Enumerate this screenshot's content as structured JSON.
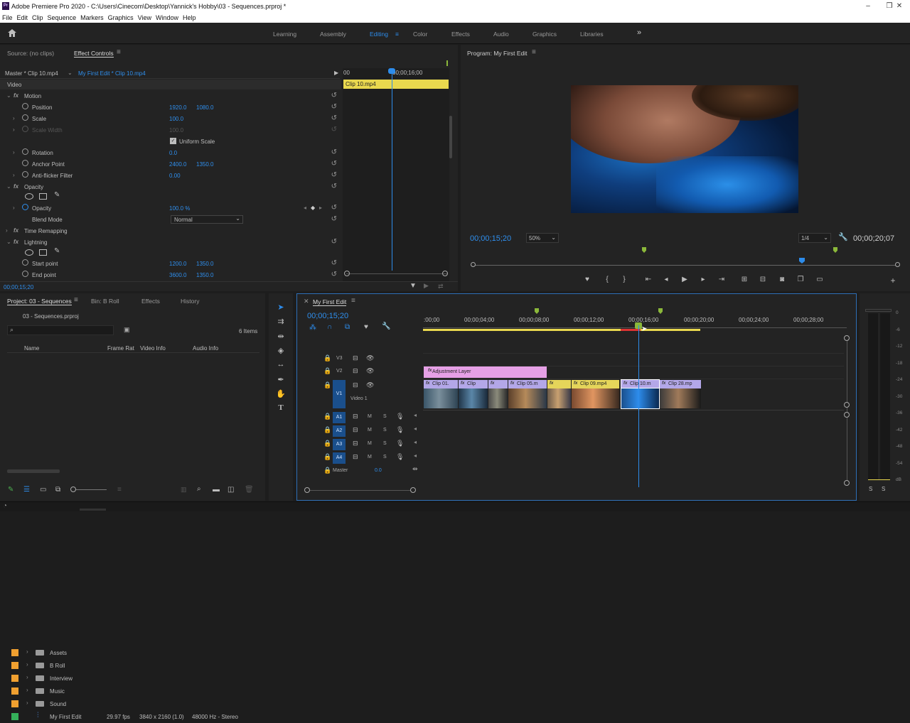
{
  "window": {
    "title": "Adobe Premiere Pro 2020 - C:\\Users\\Cinecom\\Desktop\\Yannick's Hobby\\03 - Sequences.prproj *",
    "app_icon_text": "Pr",
    "minimize": "–",
    "maximize": "❒",
    "close": "✕"
  },
  "menu": [
    "File",
    "Edit",
    "Clip",
    "Sequence",
    "Markers",
    "Graphics",
    "View",
    "Window",
    "Help"
  ],
  "workspaces": {
    "items": [
      "Learning",
      "Assembly",
      "Editing",
      "Color",
      "Effects",
      "Audio",
      "Graphics",
      "Libraries"
    ],
    "active": "Editing",
    "more": "»"
  },
  "effect_controls": {
    "source_tab": "Source: (no clips)",
    "tab": "Effect Controls",
    "master_clip": "Master * Clip 10.mp4",
    "sequence_clip": "My First Edit * Clip 10.mp4",
    "timecode_start": "00",
    "timecode_mark": "00;00;16;00",
    "clip_bar_label": "Clip 10.mp4",
    "section_video": "Video",
    "motion": {
      "label": "Motion",
      "position": {
        "label": "Position",
        "x": "1920.0",
        "y": "1080.0"
      },
      "scale": {
        "label": "Scale",
        "value": "100.0"
      },
      "scale_width": {
        "label": "Scale Width",
        "value": "100.0"
      },
      "uniform_scale": "Uniform Scale",
      "rotation": {
        "label": "Rotation",
        "value": "0.0"
      },
      "anchor_point": {
        "label": "Anchor Point",
        "x": "2400.0",
        "y": "1350.0"
      },
      "anti_flicker": {
        "label": "Anti-flicker Filter",
        "value": "0.00"
      }
    },
    "opacity": {
      "label": "Opacity",
      "value_label": "Opacity",
      "value": "100.0 %",
      "blend_mode_label": "Blend Mode",
      "blend_mode": "Normal"
    },
    "time_remapping": "Time Remapping",
    "lightning": {
      "label": "Lightning",
      "start_point": {
        "label": "Start point",
        "x": "1200.0",
        "y": "1350.0"
      },
      "end_point": {
        "label": "End point",
        "x": "3600.0",
        "y": "1350.0"
      }
    },
    "bottom_timecode": "00;00;15;20"
  },
  "program": {
    "title": "Program: My First Edit",
    "timecode": "00;00;15;20",
    "zoom": "50%",
    "resolution": "1/4",
    "duration": "00;00;20;07"
  },
  "project": {
    "tabs": [
      "Project: 03 - Sequences",
      "Bin: B Roll",
      "Effects",
      "History"
    ],
    "file": "03 - Sequences.prproj",
    "items_count": "6 Items",
    "columns": [
      "Name",
      "Frame Rat",
      "Video Info",
      "Audio Info"
    ],
    "rows": [
      {
        "name": "Assets",
        "color": "#f0a030",
        "type": "folder"
      },
      {
        "name": "B Roll",
        "color": "#f0a030",
        "type": "folder"
      },
      {
        "name": "Interview",
        "color": "#f0a030",
        "type": "folder"
      },
      {
        "name": "Music",
        "color": "#f0a030",
        "type": "folder"
      },
      {
        "name": "Sound",
        "color": "#f0a030",
        "type": "folder"
      },
      {
        "name": "My First Edit",
        "color": "#35b05a",
        "type": "sequence",
        "frame_rate": "29.97 fps",
        "video_info": "3840 x 2160 (1.0)",
        "audio_info": "48000 Hz - Stereo"
      }
    ]
  },
  "timeline": {
    "title": "My First Edit",
    "timecode": "00;00;15;20",
    "ruler": [
      ":00;00",
      "00;00;04;00",
      "00;00;08;00",
      "00;00;12;00",
      "00;00;16;00",
      "00;00;20;00",
      "00;00;24;00",
      "00;00;28;00"
    ],
    "tracks": {
      "v3": "V3",
      "v2": "V2",
      "v1": "V1",
      "video1_label": "Video 1",
      "a1": "A1",
      "a2": "A2",
      "a3": "A3",
      "a4": "A4",
      "master": "Master",
      "master_value": "0.0",
      "m": "M",
      "s": "S"
    },
    "clips": {
      "adjustment": "Adjustment Layer",
      "clip01": "Clip 01.",
      "clip": "Clip",
      "clip05": "Clip 05.m",
      "clip09": "Clip 09.mp4",
      "clip10": "Clip 10.m",
      "clip28": "Clip 28.mp"
    }
  },
  "meter": {
    "labels": [
      "0",
      "-6",
      "-12",
      "-18",
      "-24",
      "-30",
      "-36",
      "-42",
      "-48",
      "-54",
      "dB"
    ],
    "solo": "S"
  },
  "colors": {
    "accent_blue": "#2d8ceb",
    "adjustment_pink": "#e6a0e6",
    "clip_purple": "#b3a7e8",
    "clip_yellow": "#e5d55a",
    "effect_bar_yellow": "#e9d84e"
  }
}
